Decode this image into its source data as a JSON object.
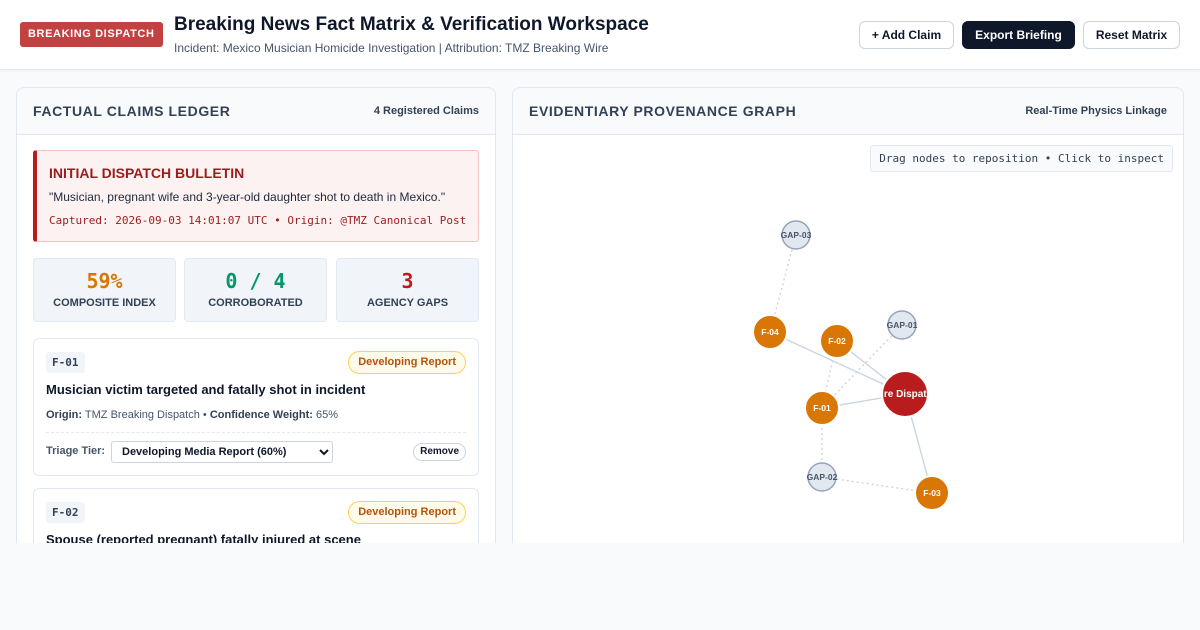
{
  "header": {
    "badge": "BREAKING DISPATCH",
    "title": "Breaking News Fact Matrix & Verification Workspace",
    "subtitle": "Incident: Mexico Musician Homicide Investigation | Attribution: TMZ Breaking Wire",
    "buttons": {
      "add_claim": "+ Add Claim",
      "export": "Export Briefing",
      "reset": "Reset Matrix"
    }
  },
  "ledger": {
    "title": "Factual Claims Ledger",
    "count": "4 Registered Claims",
    "bulletin": {
      "title": "INITIAL DISPATCH BULLETIN",
      "quote": "\"Musician, pregnant wife and 3-year-old daughter shot to death in Mexico.\"",
      "captured": "Captured: 2026-09-03 14:01:07 UTC",
      "separator": " • ",
      "origin": "Origin: @TMZ Canonical Post"
    },
    "stats": [
      {
        "value": "59%",
        "label": "Composite Index",
        "color": "#d97706"
      },
      {
        "value": "0 / 4",
        "label": "Corroborated",
        "color": "#059669"
      },
      {
        "value": "3",
        "label": "Agency Gaps",
        "color": "#b91c1c"
      }
    ],
    "claims": [
      {
        "id": "F-01",
        "status": "Developing Report",
        "text": "Musician victim targeted and fatally shot in incident",
        "origin_label": "Origin:",
        "origin": "TMZ Breaking Dispatch",
        "weight_label": "Confidence Weight:",
        "weight": "65%",
        "tier_label": "Triage Tier:",
        "tier": "Developing Media Report (60%)",
        "remove": "Remove"
      },
      {
        "id": "F-02",
        "status": "Developing Report",
        "text": "Spouse (reported pregnant) fatally injured at scene"
      }
    ]
  },
  "graph": {
    "title": "Evidentiary Provenance Graph",
    "meta": "Real-Time Physics Linkage",
    "hint": "Drag nodes to reposition • Click to inspect",
    "colors": {
      "claim": "#d97706",
      "source": "#b91c1c",
      "gap_fill": "#e2e8f0",
      "gap_stroke": "#94a3b8",
      "edge": "#cbd5e1"
    },
    "nodes": [
      {
        "id": "GAP-03",
        "label": "GAP-03",
        "kind": "gap"
      },
      {
        "id": "F-04",
        "label": "F-04",
        "kind": "claim"
      },
      {
        "id": "F-02",
        "label": "F-02",
        "kind": "claim"
      },
      {
        "id": "GAP-01",
        "label": "GAP-01",
        "kind": "gap"
      },
      {
        "id": "WIRE",
        "label": "Wire Dispatch",
        "kind": "source"
      },
      {
        "id": "F-01",
        "label": "F-01",
        "kind": "claim"
      },
      {
        "id": "GAP-02",
        "label": "GAP-02",
        "kind": "gap"
      },
      {
        "id": "F-03",
        "label": "F-03",
        "kind": "claim"
      }
    ],
    "edges": [
      {
        "from": "GAP-03",
        "to": "F-04",
        "style": "dotted"
      },
      {
        "from": "F-04",
        "to": "WIRE",
        "style": "solid"
      },
      {
        "from": "F-02",
        "to": "WIRE",
        "style": "solid"
      },
      {
        "from": "GAP-01",
        "to": "F-01",
        "style": "dotted"
      },
      {
        "from": "F-02",
        "to": "F-01",
        "style": "dotted"
      },
      {
        "from": "F-01",
        "to": "WIRE",
        "style": "solid"
      },
      {
        "from": "F-01",
        "to": "GAP-02",
        "style": "dotted"
      },
      {
        "from": "GAP-02",
        "to": "F-03",
        "style": "dotted"
      },
      {
        "from": "WIRE",
        "to": "F-03",
        "style": "solid"
      }
    ]
  }
}
